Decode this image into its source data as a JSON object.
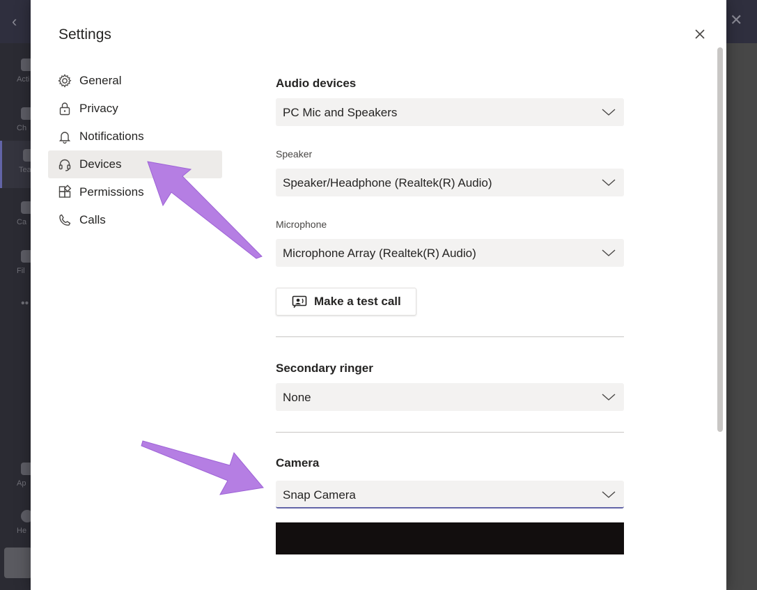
{
  "background_app": {
    "rail_labels": [
      "Acti",
      "Ch",
      "Tea",
      "Ca",
      "Fil",
      "Ap",
      "He"
    ]
  },
  "dialog": {
    "title": "Settings",
    "nav": [
      {
        "label": "General",
        "icon": "gear-icon"
      },
      {
        "label": "Privacy",
        "icon": "lock-icon"
      },
      {
        "label": "Notifications",
        "icon": "bell-icon"
      },
      {
        "label": "Devices",
        "icon": "headset-icon",
        "selected": true
      },
      {
        "label": "Permissions",
        "icon": "permissions-icon"
      },
      {
        "label": "Calls",
        "icon": "phone-icon"
      }
    ],
    "audio": {
      "title": "Audio devices",
      "device_value": "PC Mic and Speakers",
      "speaker_label": "Speaker",
      "speaker_value": "Speaker/Headphone (Realtek(R) Audio)",
      "microphone_label": "Microphone",
      "microphone_value": "Microphone Array (Realtek(R) Audio)",
      "test_call_label": "Make a test call"
    },
    "secondary_ringer": {
      "title": "Secondary ringer",
      "value": "None"
    },
    "camera": {
      "title": "Camera",
      "value": "Snap Camera"
    }
  },
  "colors": {
    "accent": "#6264a7",
    "annotation_arrow": "#b57ee3",
    "dropdown_bg": "#f3f2f1",
    "selected_nav_bg": "#edebe9"
  }
}
